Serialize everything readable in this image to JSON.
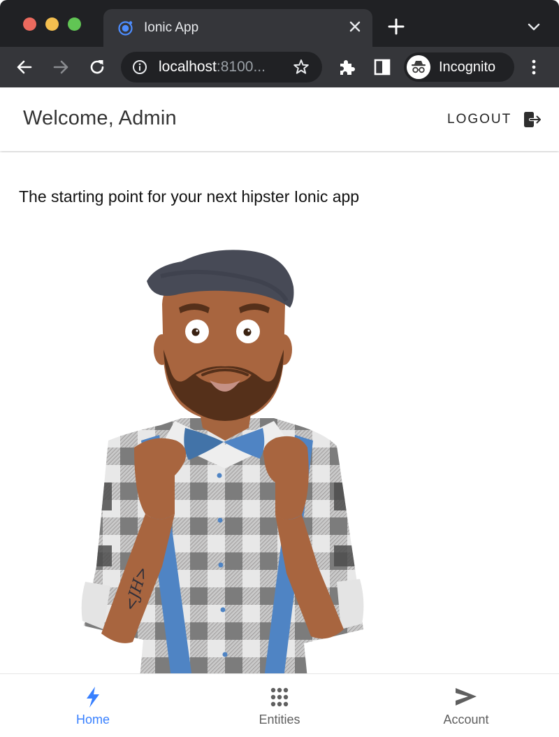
{
  "browser": {
    "tab": {
      "title": "Ionic App",
      "favicon": "ionic-logo-icon",
      "close_icon": "close-icon"
    },
    "new_tab_icon": "plus-icon",
    "tab_list_icon": "chevron-down-icon",
    "nav": {
      "back_icon": "arrow-left-icon",
      "forward_icon": "arrow-right-icon",
      "reload_icon": "reload-icon"
    },
    "address_bar": {
      "host": "localhost",
      "rest": ":8100...",
      "info_icon": "info-icon",
      "bookmark_icon": "star-icon"
    },
    "extensions_icon": "puzzle-icon",
    "side_panel_icon": "side-panel-icon",
    "profile": {
      "label": "Incognito",
      "icon": "incognito-icon"
    },
    "menu_icon": "kebab-menu-icon"
  },
  "header": {
    "title": "Welcome, Admin",
    "logout_label": "LOGOUT",
    "logout_icon": "logout-icon"
  },
  "main": {
    "tagline": "The starting point for your next hipster Ionic app",
    "illustration": {
      "description": "hipster character illustration",
      "tattoo_text": "<JH>"
    }
  },
  "tabbar": {
    "items": [
      {
        "label": "Home",
        "icon": "flash-icon",
        "active": true
      },
      {
        "label": "Entities",
        "icon": "apps-grid-icon",
        "active": false
      },
      {
        "label": "Account",
        "icon": "send-icon",
        "active": false
      }
    ]
  },
  "colors": {
    "accent": "#3880ff",
    "inactive_tab": "#5f5f5f",
    "chrome_dark": "#202124",
    "chrome_toolbar": "#35363a"
  }
}
